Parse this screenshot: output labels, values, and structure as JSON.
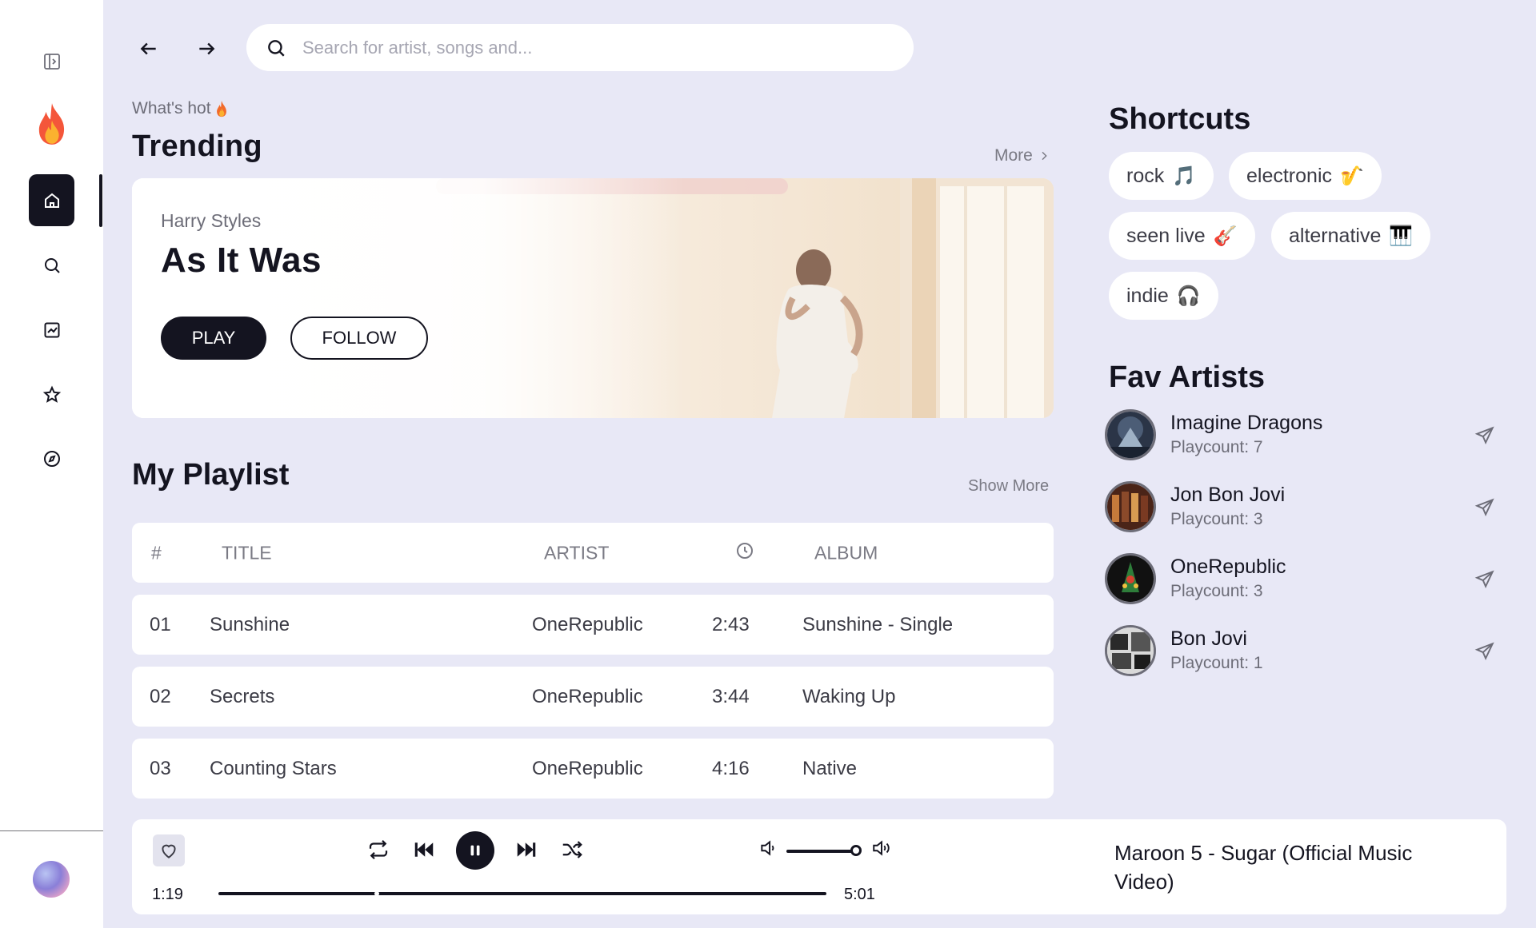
{
  "search": {
    "placeholder": "Search for artist, songs and..."
  },
  "trending": {
    "eyebrow": "What's hot",
    "title": "Trending",
    "more_label": "More",
    "artist": "Harry Styles",
    "song": "As It Was",
    "play_label": "PLAY",
    "follow_label": "FOLLOW"
  },
  "playlist": {
    "title": "My Playlist",
    "show_more_label": "Show More",
    "columns": {
      "index": "#",
      "title": "TITLE",
      "artist": "ARTIST",
      "album": "ALBUM"
    },
    "rows": [
      {
        "index": "01",
        "title": "Sunshine",
        "artist": "OneRepublic",
        "duration": "2:43",
        "album": "Sunshine - Single"
      },
      {
        "index": "02",
        "title": "Secrets",
        "artist": "OneRepublic",
        "duration": "3:44",
        "album": "Waking Up"
      },
      {
        "index": "03",
        "title": "Counting Stars",
        "artist": "OneRepublic",
        "duration": "4:16",
        "album": "Native"
      }
    ]
  },
  "shortcuts": {
    "title": "Shortcuts",
    "items": [
      {
        "label": "rock",
        "icon": "🎵"
      },
      {
        "label": "electronic",
        "icon": "🎷"
      },
      {
        "label": "seen live",
        "icon": "🎸"
      },
      {
        "label": "alternative",
        "icon": "🎹"
      },
      {
        "label": "indie",
        "icon": "🎧"
      }
    ]
  },
  "fav_artists": {
    "title": "Fav Artists",
    "items": [
      {
        "name": "Imagine Dragons",
        "playcount": "Playcount: 7"
      },
      {
        "name": "Jon Bon Jovi",
        "playcount": "Playcount: 3"
      },
      {
        "name": "OneRepublic",
        "playcount": "Playcount: 3"
      },
      {
        "name": "Bon Jovi",
        "playcount": "Playcount: 1"
      }
    ]
  },
  "player": {
    "current_time": "1:19",
    "total_time": "5:01",
    "progress": 0.26,
    "volume": 0.95,
    "now_playing": "Maroon 5 - Sugar (Official Music Video)"
  },
  "colors": {
    "accent": "#141420",
    "background": "#e8e8f6",
    "card": "#ffffff",
    "muted": "#6d6d78"
  }
}
